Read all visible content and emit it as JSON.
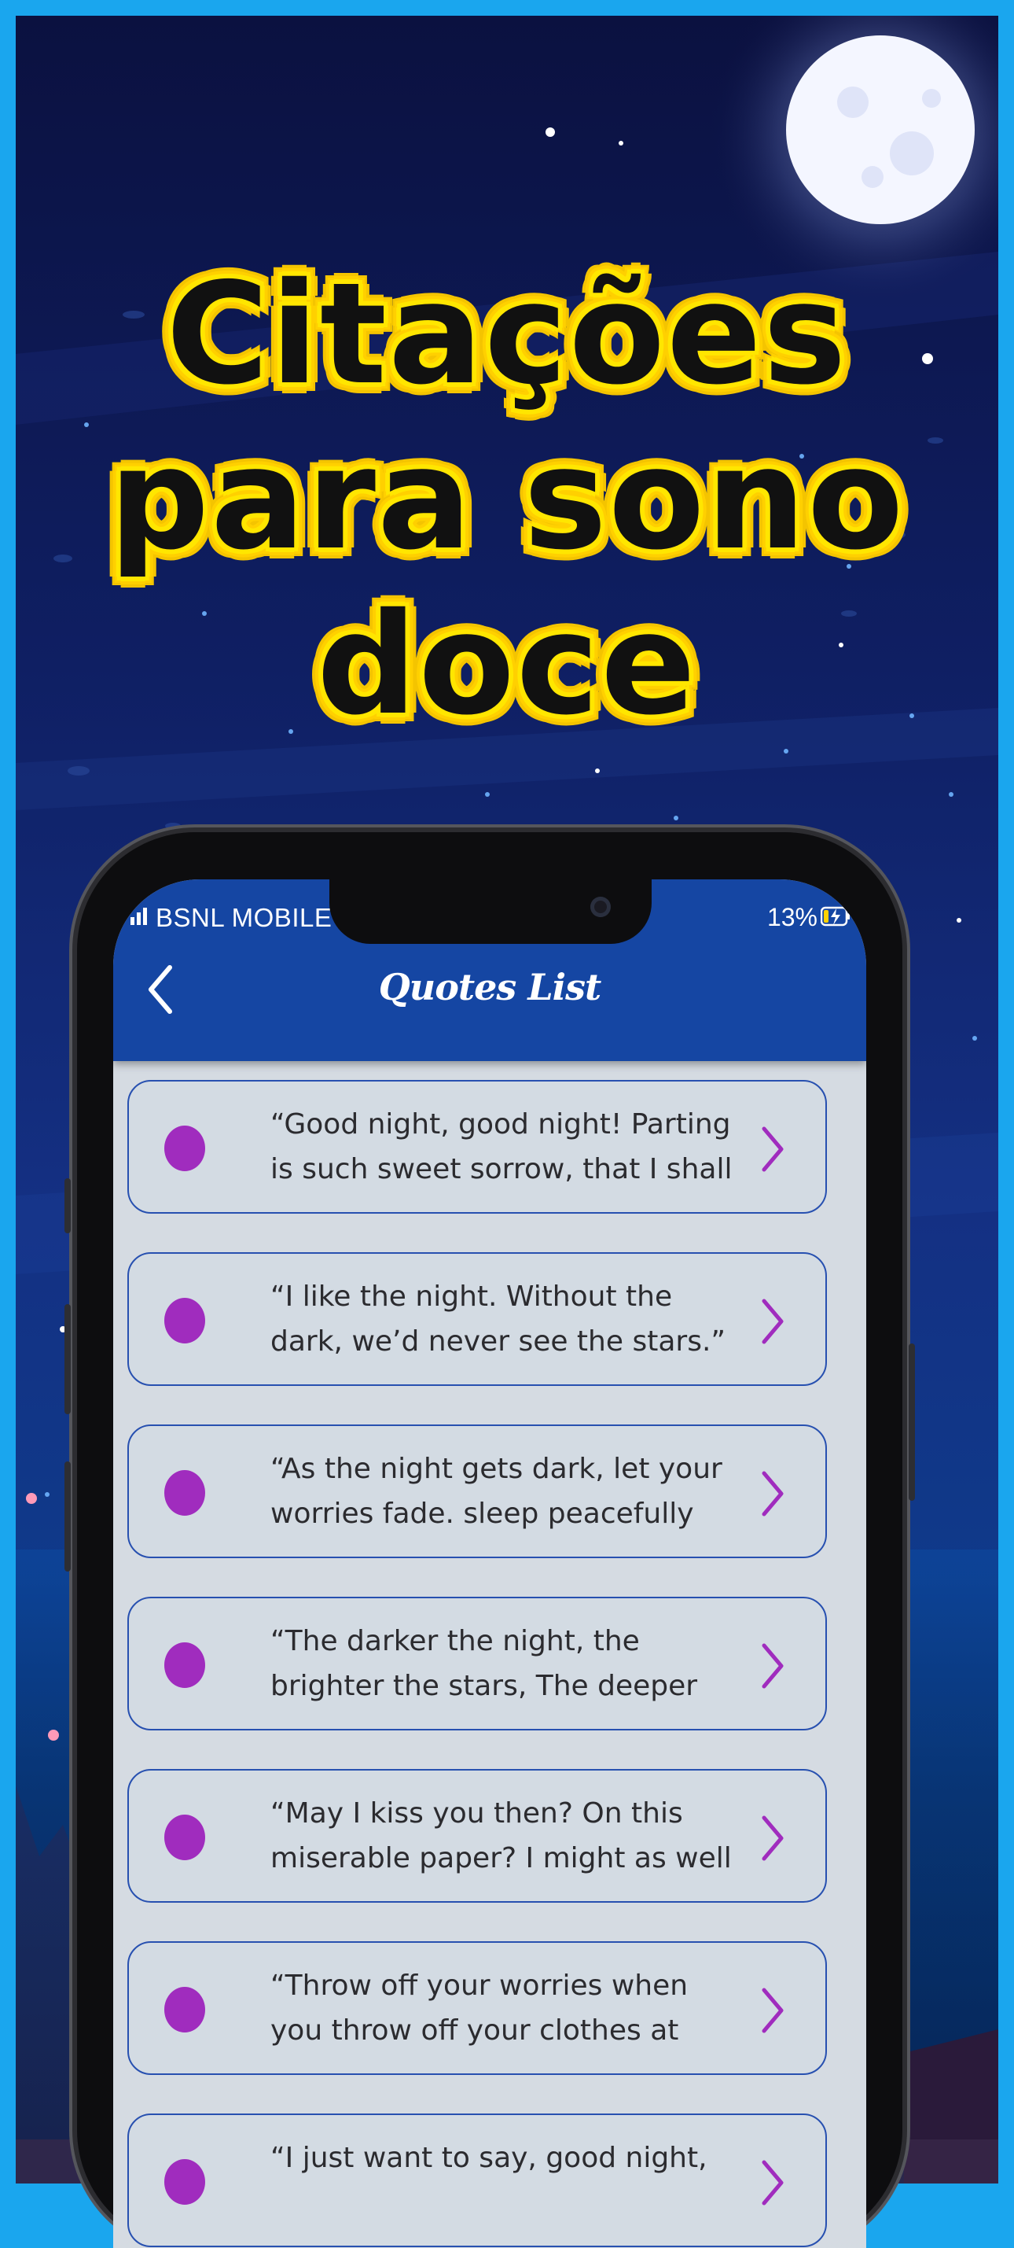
{
  "headline": {
    "lines": [
      "Citações",
      "para sono",
      "doce"
    ]
  },
  "status_bar": {
    "carrier": "BSNL MOBILE",
    "battery": "13%"
  },
  "app_bar": {
    "title": "Quotes List",
    "back_icon": "chevron-left-icon"
  },
  "quotes": [
    {
      "text": "“Good night, good night! Parting is such sweet sorrow, that I shall"
    },
    {
      "text": "“I like the night. Without the dark, we’d never see the stars.” –"
    },
    {
      "text": "“As the night gets dark, let your worries fade. sleep peacefully"
    },
    {
      "text": "“The darker the night, the brighter the stars, The deeper the"
    },
    {
      "text": "“May I kiss you then? On this miserable paper? I might as well"
    },
    {
      "text": "“Throw off your worries when you throw off your clothes at night.” –"
    },
    {
      "text": "“I just want to say, good night,"
    }
  ],
  "colors": {
    "border": "#1aa6ee",
    "app_bar": "#1546a3",
    "headline_fill": "#111111",
    "headline_outline": "#ffe600",
    "bullet": "#a02cbe",
    "card_border": "#2750b0",
    "card_bg": "#d3dbe3"
  }
}
